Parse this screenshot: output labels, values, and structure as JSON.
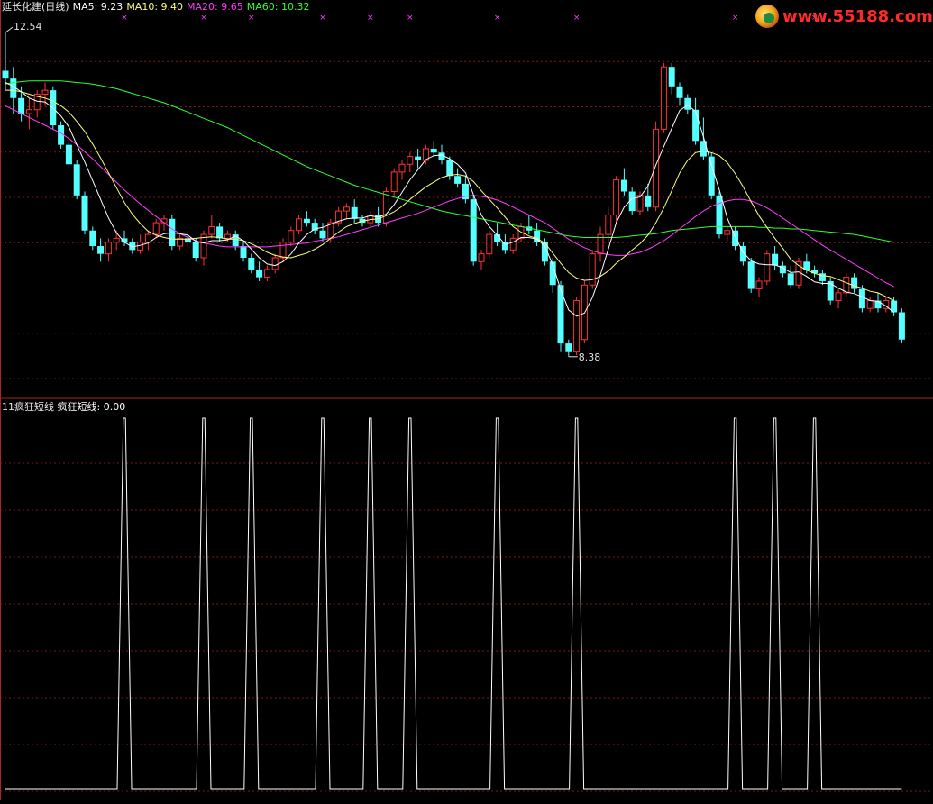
{
  "header": {
    "stock_name": "延长化建(日线)",
    "ma5": "MA5: 9.23",
    "ma10": "MA10: 9.40",
    "ma20": "MA20: 9.65",
    "ma60": "MA60: 10.32"
  },
  "lower_header": {
    "indicator_name": "11疯狂短线",
    "value_label": "疯狂短线: 0.00"
  },
  "annotations": {
    "high_label": "12.54",
    "low_label": "8.38"
  },
  "logo_text": "www.55188.com",
  "colors": {
    "background": "#000000",
    "up": "#ff3232",
    "down": "#54ffff",
    "ma5": "#ffffff",
    "ma10": "#ffff80",
    "ma20": "#ff3cff",
    "ma60": "#32ff32",
    "divider": "#a02828",
    "grid": "#7a1a1a",
    "signal_line": "#ffffff",
    "signal_marker": "#ff3cff"
  },
  "chart_data": [
    {
      "type": "candlestick",
      "title": "延长化建(日线)",
      "ylim": [
        8.1,
        12.75
      ],
      "high": 12.54,
      "low": 8.38,
      "grid": true,
      "ohlc": [
        [
          12.05,
          12.54,
          11.8,
          11.95
        ],
        [
          11.95,
          12.1,
          11.5,
          11.7
        ],
        [
          11.7,
          11.85,
          11.4,
          11.5
        ],
        [
          11.5,
          11.7,
          11.3,
          11.55
        ],
        [
          11.55,
          11.8,
          11.45,
          11.75
        ],
        [
          11.75,
          11.9,
          11.6,
          11.8
        ],
        [
          11.8,
          11.85,
          11.3,
          11.35
        ],
        [
          11.35,
          11.4,
          11.05,
          11.1
        ],
        [
          11.1,
          11.15,
          10.8,
          10.85
        ],
        [
          10.85,
          10.9,
          10.4,
          10.45
        ],
        [
          10.45,
          10.5,
          9.95,
          10.0
        ],
        [
          10.0,
          10.05,
          9.75,
          9.8
        ],
        [
          9.8,
          9.9,
          9.6,
          9.7
        ],
        [
          9.7,
          9.9,
          9.6,
          9.85
        ],
        [
          9.85,
          10.0,
          9.75,
          9.9
        ],
        [
          9.9,
          10.0,
          9.8,
          9.85
        ],
        [
          9.85,
          9.9,
          9.7,
          9.75
        ],
        [
          9.75,
          9.95,
          9.7,
          9.85
        ],
        [
          9.85,
          10.0,
          9.75,
          9.95
        ],
        [
          9.95,
          10.15,
          9.9,
          10.1
        ],
        [
          10.1,
          10.2,
          10.0,
          10.15
        ],
        [
          10.15,
          10.2,
          9.75,
          9.8
        ],
        [
          9.8,
          9.95,
          9.75,
          9.9
        ],
        [
          9.9,
          10.0,
          9.8,
          9.85
        ],
        [
          9.85,
          9.9,
          9.6,
          9.65
        ],
        [
          9.65,
          10.0,
          9.55,
          9.95
        ],
        [
          9.95,
          10.2,
          9.9,
          10.05
        ],
        [
          10.05,
          10.1,
          9.85,
          9.9
        ],
        [
          9.9,
          10.0,
          9.85,
          9.95
        ],
        [
          9.95,
          10.0,
          9.75,
          9.8
        ],
        [
          9.8,
          9.85,
          9.6,
          9.65
        ],
        [
          9.65,
          9.7,
          9.45,
          9.5
        ],
        [
          9.5,
          9.6,
          9.35,
          9.4
        ],
        [
          9.4,
          9.55,
          9.35,
          9.5
        ],
        [
          9.5,
          9.7,
          9.45,
          9.65
        ],
        [
          9.65,
          9.9,
          9.6,
          9.85
        ],
        [
          9.85,
          10.05,
          9.8,
          10.0
        ],
        [
          10.0,
          10.2,
          9.95,
          10.15
        ],
        [
          10.15,
          10.25,
          10.05,
          10.1
        ],
        [
          10.1,
          10.15,
          9.95,
          10.0
        ],
        [
          10.0,
          10.1,
          9.85,
          9.9
        ],
        [
          9.9,
          10.15,
          9.85,
          10.1
        ],
        [
          10.1,
          10.3,
          10.05,
          10.25
        ],
        [
          10.25,
          10.35,
          10.15,
          10.3
        ],
        [
          10.3,
          10.4,
          10.1,
          10.15
        ],
        [
          10.15,
          10.2,
          10.05,
          10.1
        ],
        [
          10.1,
          10.25,
          10.05,
          10.2
        ],
        [
          10.2,
          10.3,
          10.05,
          10.1
        ],
        [
          10.1,
          10.55,
          10.05,
          10.5
        ],
        [
          10.5,
          10.8,
          10.45,
          10.75
        ],
        [
          10.75,
          10.9,
          10.65,
          10.85
        ],
        [
          10.85,
          11.0,
          10.75,
          10.95
        ],
        [
          10.95,
          11.05,
          10.8,
          10.9
        ],
        [
          10.9,
          11.1,
          10.85,
          11.05
        ],
        [
          11.05,
          11.15,
          10.95,
          11.0
        ],
        [
          11.0,
          11.1,
          10.85,
          10.9
        ],
        [
          10.9,
          10.95,
          10.65,
          10.7
        ],
        [
          10.7,
          10.8,
          10.55,
          10.6
        ],
        [
          10.6,
          10.7,
          10.35,
          10.4
        ],
        [
          10.4,
          10.45,
          9.55,
          9.6
        ],
        [
          9.6,
          9.75,
          9.5,
          9.7
        ],
        [
          9.7,
          10.0,
          9.65,
          9.95
        ],
        [
          9.95,
          10.1,
          9.8,
          9.85
        ],
        [
          9.85,
          9.95,
          9.7,
          9.75
        ],
        [
          9.75,
          9.95,
          9.7,
          9.9
        ],
        [
          9.9,
          10.1,
          9.85,
          10.05
        ],
        [
          10.05,
          10.2,
          9.95,
          10.0
        ],
        [
          10.0,
          10.1,
          9.8,
          9.85
        ],
        [
          9.85,
          9.9,
          9.55,
          9.6
        ],
        [
          9.6,
          9.65,
          9.2,
          9.3
        ],
        [
          9.3,
          9.35,
          8.45,
          8.55
        ],
        [
          8.55,
          8.6,
          8.38,
          8.45
        ],
        [
          8.45,
          9.15,
          8.4,
          9.1
        ],
        [
          8.6,
          9.35,
          8.55,
          9.3
        ],
        [
          9.3,
          9.75,
          9.25,
          9.7
        ],
        [
          9.7,
          10.05,
          9.6,
          9.95
        ],
        [
          9.95,
          10.3,
          9.85,
          10.2
        ],
        [
          10.2,
          10.7,
          10.1,
          10.65
        ],
        [
          10.65,
          10.8,
          10.45,
          10.5
        ],
        [
          10.5,
          10.55,
          10.2,
          10.25
        ],
        [
          10.25,
          10.5,
          10.2,
          10.45
        ],
        [
          10.45,
          10.6,
          10.25,
          10.3
        ],
        [
          10.3,
          11.4,
          10.25,
          11.3
        ],
        [
          11.3,
          12.15,
          11.25,
          12.1
        ],
        [
          12.1,
          12.15,
          11.75,
          11.85
        ],
        [
          11.85,
          11.9,
          11.6,
          11.7
        ],
        [
          11.7,
          11.75,
          11.5,
          11.55
        ],
        [
          11.55,
          11.7,
          11.1,
          11.15
        ],
        [
          11.15,
          11.45,
          10.9,
          10.95
        ],
        [
          10.95,
          11.0,
          10.4,
          10.45
        ],
        [
          10.45,
          10.5,
          9.9,
          9.95
        ],
        [
          9.95,
          10.05,
          9.85,
          10.0
        ],
        [
          10.0,
          10.05,
          9.75,
          9.8
        ],
        [
          9.8,
          9.85,
          9.55,
          9.6
        ],
        [
          9.6,
          9.65,
          9.2,
          9.25
        ],
        [
          9.25,
          9.4,
          9.15,
          9.35
        ],
        [
          9.35,
          9.75,
          9.3,
          9.7
        ],
        [
          9.7,
          9.8,
          9.5,
          9.55
        ],
        [
          9.55,
          9.6,
          9.4,
          9.45
        ],
        [
          9.45,
          9.55,
          9.25,
          9.3
        ],
        [
          9.3,
          9.65,
          9.25,
          9.6
        ],
        [
          9.6,
          9.7,
          9.45,
          9.5
        ],
        [
          9.5,
          9.55,
          9.4,
          9.45
        ],
        [
          9.45,
          9.5,
          9.3,
          9.35
        ],
        [
          9.35,
          9.4,
          9.05,
          9.1
        ],
        [
          9.1,
          9.25,
          9.0,
          9.2
        ],
        [
          9.2,
          9.45,
          9.15,
          9.4
        ],
        [
          9.4,
          9.45,
          9.2,
          9.25
        ],
        [
          9.25,
          9.3,
          8.95,
          9.0
        ],
        [
          9.0,
          9.15,
          8.95,
          9.1
        ],
        [
          9.1,
          9.2,
          8.95,
          9.0
        ],
        [
          9.0,
          9.15,
          8.95,
          9.1
        ],
        [
          9.1,
          9.15,
          8.9,
          8.95
        ],
        [
          8.95,
          9.0,
          8.55,
          8.6
        ]
      ],
      "ma5": [
        11.9,
        11.85,
        11.78,
        11.7,
        11.66,
        11.65,
        11.57,
        11.47,
        11.33,
        11.1,
        10.88,
        10.64,
        10.4,
        10.16,
        9.97,
        9.85,
        9.79,
        9.81,
        9.84,
        9.91,
        9.96,
        9.97,
        9.96,
        9.94,
        9.86,
        9.84,
        9.87,
        9.87,
        9.88,
        9.93,
        9.87,
        9.76,
        9.65,
        9.57,
        9.55,
        9.6,
        9.7,
        9.84,
        9.95,
        10.02,
        10.04,
        10.08,
        10.12,
        10.15,
        10.16,
        10.16,
        10.19,
        10.17,
        10.21,
        10.33,
        10.49,
        10.65,
        10.78,
        10.91,
        10.96,
        10.97,
        10.92,
        10.85,
        10.74,
        10.46,
        10.2,
        10.05,
        9.94,
        9.82,
        9.85,
        9.91,
        9.91,
        9.89,
        9.8,
        9.56,
        9.24,
        8.98,
        8.9,
        8.94,
        9.14,
        9.43,
        9.76,
        10.1,
        10.3,
        10.41,
        10.43,
        10.57,
        10.84,
        11.08,
        11.31,
        11.54,
        11.61,
        11.53,
        11.2,
        10.84,
        10.52,
        10.16,
        9.92,
        9.72,
        9.61,
        9.57,
        9.56,
        9.56,
        9.52,
        9.46,
        9.47,
        9.41,
        9.34,
        9.32,
        9.32,
        9.26,
        9.21,
        9.19,
        9.15,
        9.1,
        9.09,
        9.03,
        8.95
      ],
      "ma10": [
        11.8,
        11.8,
        11.78,
        11.75,
        11.72,
        11.7,
        11.66,
        11.6,
        11.52,
        11.4,
        11.27,
        11.11,
        10.93,
        10.74,
        10.55,
        10.36,
        10.21,
        10.09,
        9.99,
        9.94,
        9.91,
        9.89,
        9.89,
        9.89,
        9.9,
        9.91,
        9.92,
        9.91,
        9.89,
        9.89,
        9.87,
        9.83,
        9.78,
        9.72,
        9.68,
        9.66,
        9.65,
        9.68,
        9.71,
        9.76,
        9.82,
        9.9,
        9.98,
        10.05,
        10.09,
        10.12,
        10.14,
        10.15,
        10.19,
        10.24,
        10.31,
        10.4,
        10.48,
        10.56,
        10.62,
        10.68,
        10.71,
        10.72,
        10.7,
        10.63,
        10.51,
        10.4,
        10.29,
        10.17,
        10.05,
        9.98,
        9.93,
        9.9,
        9.84,
        9.71,
        9.58,
        9.46,
        9.39,
        9.36,
        9.37,
        9.41,
        9.48,
        9.58,
        9.66,
        9.75,
        9.83,
        9.94,
        10.1,
        10.29,
        10.51,
        10.74,
        10.9,
        11.0,
        11.02,
        11.0,
        10.96,
        10.87,
        10.73,
        10.56,
        10.37,
        10.19,
        10.04,
        9.9,
        9.77,
        9.63,
        9.55,
        9.49,
        9.45,
        9.42,
        9.41,
        9.37,
        9.33,
        9.29,
        9.26,
        9.22,
        9.2,
        9.15,
        9.1
      ],
      "ma20": [
        11.6,
        11.55,
        11.5,
        11.45,
        11.4,
        11.35,
        11.3,
        11.25,
        11.18,
        11.1,
        11.01,
        10.92,
        10.82,
        10.72,
        10.62,
        10.52,
        10.43,
        10.34,
        10.26,
        10.18,
        10.1,
        10.02,
        9.96,
        9.91,
        9.87,
        9.84,
        9.82,
        9.8,
        9.79,
        9.79,
        9.79,
        9.79,
        9.79,
        9.79,
        9.8,
        9.81,
        9.82,
        9.83,
        9.84,
        9.86,
        9.88,
        9.9,
        9.92,
        9.95,
        9.98,
        10.01,
        10.04,
        10.07,
        10.1,
        10.13,
        10.16,
        10.19,
        10.22,
        10.26,
        10.3,
        10.34,
        10.38,
        10.41,
        10.44,
        10.45,
        10.44,
        10.42,
        10.39,
        10.35,
        10.3,
        10.25,
        10.2,
        10.15,
        10.1,
        10.03,
        9.96,
        9.89,
        9.83,
        9.78,
        9.74,
        9.71,
        9.69,
        9.68,
        9.68,
        9.7,
        9.72,
        9.76,
        9.81,
        9.87,
        9.94,
        10.02,
        10.1,
        10.18,
        10.25,
        10.31,
        10.35,
        10.38,
        10.4,
        10.4,
        10.38,
        10.34,
        10.29,
        10.23,
        10.16,
        10.09,
        10.02,
        9.95,
        9.88,
        9.81,
        9.75,
        9.69,
        9.63,
        9.57,
        9.51,
        9.45,
        9.39,
        9.33,
        9.28
      ],
      "ma60": [
        11.88,
        11.9,
        11.91,
        11.92,
        11.92,
        11.92,
        11.92,
        11.92,
        11.91,
        11.9,
        11.89,
        11.88,
        11.86,
        11.84,
        11.82,
        11.79,
        11.76,
        11.73,
        11.7,
        11.67,
        11.64,
        11.6,
        11.56,
        11.52,
        11.48,
        11.44,
        11.4,
        11.36,
        11.32,
        11.27,
        11.22,
        11.17,
        11.12,
        11.07,
        11.02,
        10.97,
        10.92,
        10.87,
        10.82,
        10.78,
        10.74,
        10.7,
        10.66,
        10.62,
        10.58,
        10.55,
        10.52,
        10.49,
        10.46,
        10.43,
        10.4,
        10.37,
        10.34,
        10.31,
        10.28,
        10.25,
        10.23,
        10.21,
        10.19,
        10.17,
        10.15,
        10.13,
        10.11,
        10.09,
        10.07,
        10.05,
        10.03,
        10.01,
        9.99,
        9.97,
        9.95,
        9.93,
        9.92,
        9.91,
        9.91,
        9.91,
        9.91,
        9.91,
        9.92,
        9.93,
        9.94,
        9.95,
        9.96,
        9.98,
        10.0,
        10.01,
        10.02,
        10.03,
        10.04,
        10.05,
        10.05,
        10.05,
        10.05,
        10.05,
        10.05,
        10.04,
        10.04,
        10.03,
        10.03,
        10.02,
        10.02,
        10.01,
        10.0,
        9.99,
        9.98,
        9.97,
        9.96,
        9.95,
        9.93,
        9.91,
        9.89,
        9.87,
        9.85
      ]
    },
    {
      "type": "line",
      "title": "疯狂短线",
      "ylim": [
        0,
        1
      ],
      "current_value": 0.0,
      "spike_bar_indices": [
        15,
        25,
        31,
        40,
        46,
        51,
        62,
        72,
        92,
        97,
        102
      ]
    }
  ]
}
